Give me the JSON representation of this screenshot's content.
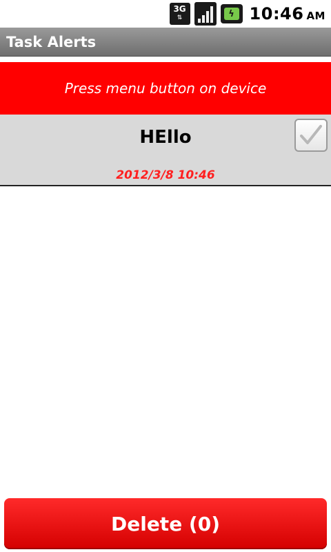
{
  "status_bar": {
    "network_label": "3G",
    "time": "10:46",
    "ampm": "AM",
    "icons": [
      "network-3g-icon",
      "signal-icon",
      "battery-icon"
    ]
  },
  "app": {
    "title": "Task Alerts"
  },
  "hint": {
    "text": "Press menu button on device"
  },
  "tasks": [
    {
      "title": "HEllo",
      "datetime": "2012/3/8  10:46",
      "checked": true
    }
  ],
  "actions": {
    "delete_label": "Delete (0)"
  },
  "colors": {
    "accent_red": "#ff0000",
    "title_bar": "#808080",
    "row_bg": "#d9d9d9",
    "date_red": "#ff2020"
  }
}
